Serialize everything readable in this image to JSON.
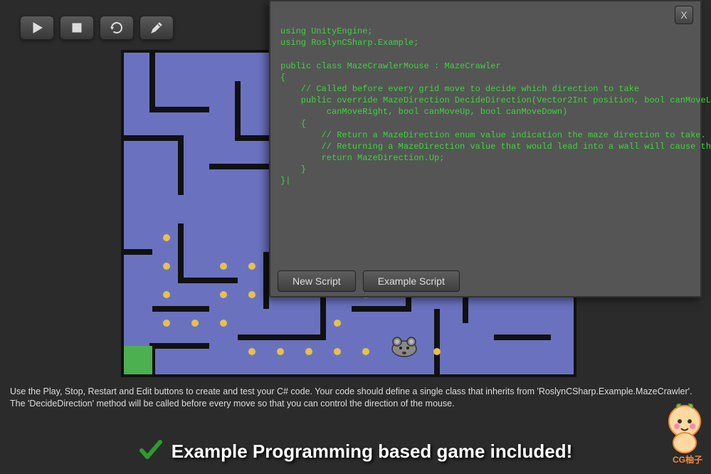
{
  "toolbar": {
    "icons": [
      "play-icon",
      "stop-icon",
      "restart-icon",
      "edit-icon"
    ]
  },
  "code_panel": {
    "close_label": "X",
    "code": "using UnityEngine;\nusing RoslynCSharp.Example;\n\npublic class MazeCrawlerMouse : MazeCrawler\n{\n    // Called before every grid move to decide which direction to take\n    public override MazeDirection DecideDirection(Vector2Int position, bool canMoveLeft, bool\n         canMoveRight, bool canMoveUp, bool canMoveDown)\n    {\n        // Return a MazeDirection enum value indication the maze direction to take.\n        // Returning a MazeDirection value that would lead into a wall will cause the maze crawl to restart\n        return MazeDirection.Up;\n    }\n}|",
    "new_script_label": "New Script",
    "example_script_label": "Example Script"
  },
  "instructions": "Use the Play, Stop, Restart and Edit buttons to create and test your C# code. Your code should define a single class that inherits from 'RoslynCSharp.Example.MazeCrawler'. The 'DecideDirection' method will be called before every move so that you can control the direction of the mouse.",
  "banner": "Example Programming based game included!",
  "watermark": "CG柚子",
  "colors": {
    "maze_bg": "#6a72c0",
    "dot": "#e8c04a",
    "code": "#3bd63b",
    "check": "#2e9b2e"
  }
}
